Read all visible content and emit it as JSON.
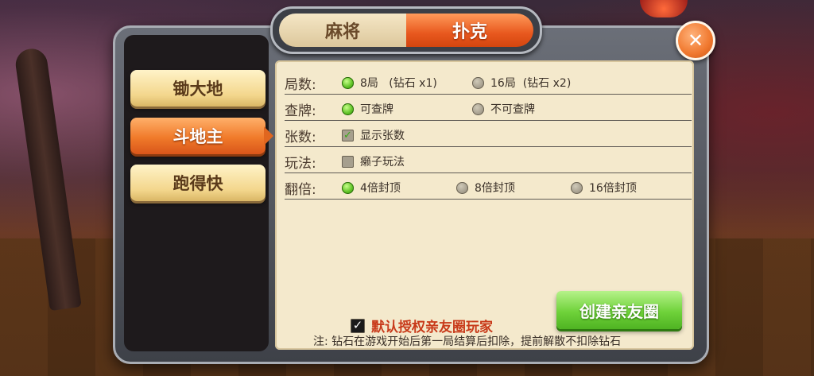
{
  "top_tabs": [
    {
      "label": "麻将",
      "active": false
    },
    {
      "label": "扑克",
      "active": true
    }
  ],
  "game_types": [
    {
      "label": "锄大地",
      "active": false
    },
    {
      "label": "斗地主",
      "active": true
    },
    {
      "label": "跑得快",
      "active": false
    }
  ],
  "rows": {
    "rounds": {
      "label": "局数:",
      "options": [
        {
          "text": "8局   (钻石 x1)",
          "selected": true
        },
        {
          "text": "16局  (钻石 x2)",
          "selected": false
        }
      ]
    },
    "view_cards": {
      "label": "查牌:",
      "options": [
        {
          "text": "可查牌",
          "selected": true
        },
        {
          "text": "不可查牌",
          "selected": false
        }
      ]
    },
    "card_count": {
      "label": "张数:",
      "option": {
        "text": "显示张数",
        "checked": true
      }
    },
    "play_style": {
      "label": "玩法:",
      "option": {
        "text": "癞子玩法",
        "checked": false
      }
    },
    "multiplier": {
      "label": "翻倍:",
      "options": [
        {
          "text": "4倍封顶",
          "selected": true
        },
        {
          "text": "8倍封顶",
          "selected": false
        },
        {
          "text": "16倍封顶",
          "selected": false
        }
      ]
    }
  },
  "authorize": {
    "text": "默认授权亲友圈玩家",
    "checked": true
  },
  "create_button": "创建亲友圈",
  "note": "注: 钻石在游戏开始后第一局结算后扣除，提前解散不扣除钻石",
  "close_icon": "close-icon",
  "colors": {
    "accent_orange": "#e8581e",
    "accent_green": "#5fc226",
    "panel_bg": "#f4e9cc"
  }
}
